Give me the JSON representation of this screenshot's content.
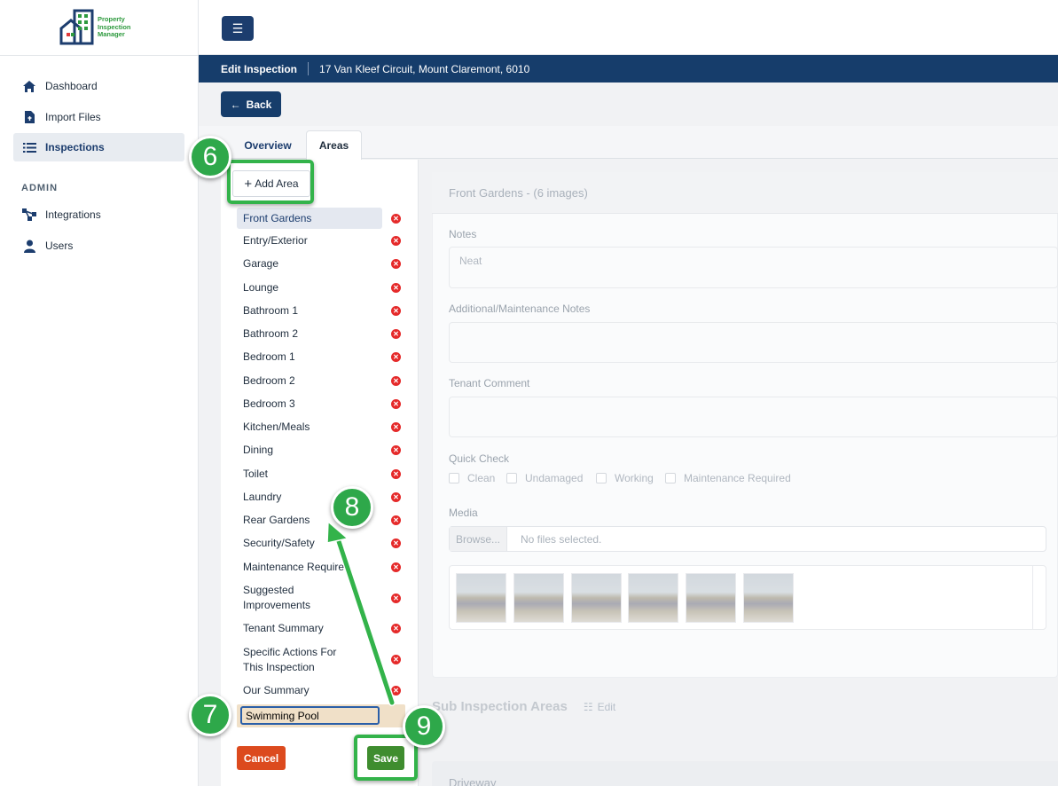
{
  "app": {
    "logo_text": "Property Inspection Manager"
  },
  "sidebar": {
    "items": [
      {
        "label": "Dashboard",
        "icon": "home-icon"
      },
      {
        "label": "Import Files",
        "icon": "file-import-icon"
      },
      {
        "label": "Inspections",
        "icon": "list-icon",
        "active": true
      }
    ],
    "admin_heading": "ADMIN",
    "admin_items": [
      {
        "label": "Integrations",
        "icon": "integrations-icon"
      },
      {
        "label": "Users",
        "icon": "user-icon"
      }
    ]
  },
  "header": {
    "title": "Edit Inspection",
    "address": "17 Van Kleef Circuit, Mount Claremont, 6010"
  },
  "back_button": "Back",
  "tabs": [
    "Overview",
    "Areas"
  ],
  "active_tab": "Areas",
  "areas": {
    "add_label": "Add Area",
    "list": [
      "Front Gardens",
      "Entry/Exterior",
      "Garage",
      "Lounge",
      "Bathroom 1",
      "Bathroom 2",
      "Bedroom 1",
      "Bedroom 2",
      "Bedroom 3",
      "Kitchen/Meals",
      "Dining",
      "Toilet",
      "Laundry",
      "Rear Gardens",
      "Security/Safety",
      "Maintenance Required",
      "Suggested Improvements",
      "Tenant Summary",
      "Specific Actions For This Inspection",
      "Our Summary"
    ],
    "selected": "Front Gardens",
    "new_area_value": "Swimming Pool",
    "cancel_label": "Cancel",
    "save_label": "Save"
  },
  "detail": {
    "header": "Front Gardens - (6 images)",
    "notes_label": "Notes",
    "notes_value": "Neat",
    "additional_label": "Additional/Maintenance Notes",
    "tenant_label": "Tenant Comment",
    "quick_check_label": "Quick Check",
    "quick_checks": [
      "Clean",
      "Undamaged",
      "Working",
      "Maintenance Required"
    ],
    "media_label": "Media",
    "browse_label": "Browse...",
    "no_files": "No files selected.",
    "image_count": 6
  },
  "sub_areas": {
    "title": "Sub Inspection Areas",
    "edit_label": "Edit",
    "first": "Driveway"
  },
  "annotations": {
    "step6": "6",
    "step7": "7",
    "step8": "8",
    "step9": "9"
  },
  "colors": {
    "accent": "#33b34a",
    "primary": "#163d6b",
    "danger": "#dc4a1e",
    "save": "#3f8d2f"
  }
}
